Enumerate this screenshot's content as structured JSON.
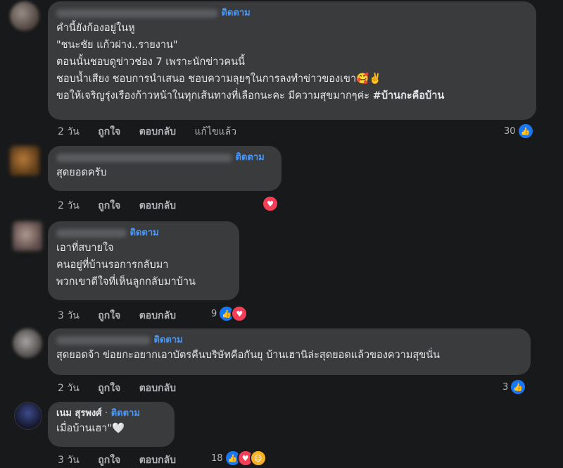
{
  "comments": [
    {
      "follow": "ติดตาม",
      "lines": [
        "คำนี้ยังก้องอยู่ในหู",
        "\"ชนะชัย แก้วผ่าง..รายงาน\"",
        "ตอนนั้นชอบดูข่าวช่อง 7 เพราะนักข่าวคนนี้",
        "ชอบน้ำเสียง ชอบการนำเสนอ ชอบความลุยๆในการลงทำข่าวของเขา🥰✌️",
        "ขอให้เจริญรุ่งเรืองก้าวหน้าในทุกเส้นทางที่เลือกนะคะ มีความสุขมากๆค่ะ "
      ],
      "hashtag": "#บ้านกะคือบ้าน",
      "time": "2 วัน",
      "like": "ถูกใจ",
      "reply": "ตอบกลับ",
      "edited": "แก้ไขแล้ว",
      "reaction_count": "30"
    },
    {
      "follow": "ติดตาม",
      "lines": [
        "สุดยอดครับ"
      ],
      "time": "2 วัน",
      "like": "ถูกใจ",
      "reply": "ตอบกลับ"
    },
    {
      "follow": "ติดตาม",
      "lines": [
        "เอาที่สบายใจ",
        "คนอยู่ที่บ้านรอการกลับมา",
        "พวกเขาดีใจที่เห็นลูกกลับมาบ้าน"
      ],
      "time": "3 วัน",
      "like": "ถูกใจ",
      "reply": "ตอบกลับ",
      "reaction_count": "9"
    },
    {
      "follow": "ติดตาม",
      "lines": [
        "สุดยอดจ้า ข่อยกะอยากเอาบัตรคืนบริษัทคือกันยุ บ้านเฮานิล่ะสุดยอดแล้วของความสุขนั่น"
      ],
      "time": "2 วัน",
      "like": "ถูกใจ",
      "reply": "ตอบกลับ",
      "reaction_count": "3"
    },
    {
      "name": "เนม สุรพงศ์",
      "sep": "·",
      "follow": "ติดตาม",
      "lines": [
        "เมื่อบ้านเฮา\"🤍"
      ],
      "time": "3 วัน",
      "like": "ถูกใจ",
      "reply": "ตอบกลับ",
      "reaction_count": "18"
    }
  ],
  "icons": {
    "like": "thumbs-up-icon",
    "love": "heart-icon",
    "care": "care-icon"
  },
  "colors": {
    "background": "#18191a",
    "bubble": "#3a3b3c",
    "link": "#4599ff",
    "like": "#1877f2",
    "love": "#f33e58"
  }
}
